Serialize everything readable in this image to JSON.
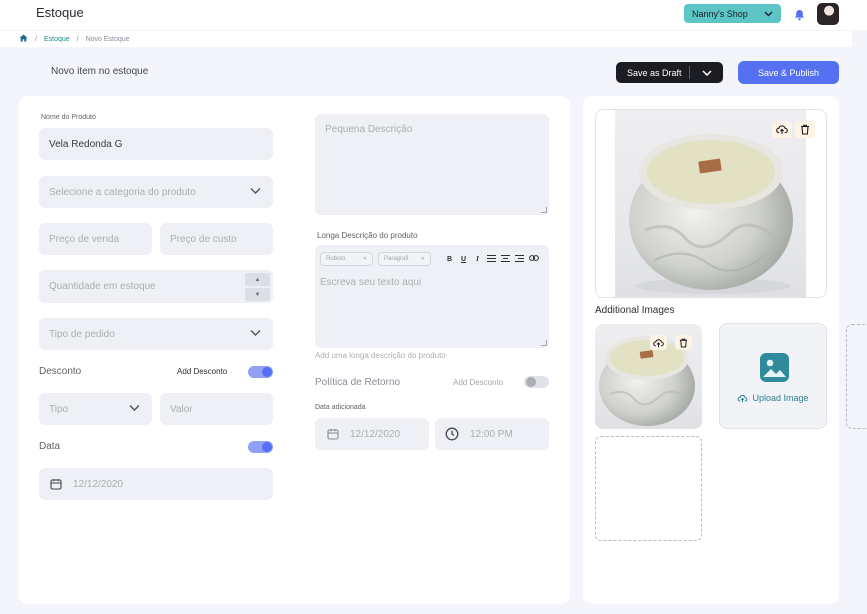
{
  "app": {
    "title": "Estoque"
  },
  "header": {
    "shop_name": "Nanny's Shop"
  },
  "breadcrumb": {
    "section": "Estoque",
    "current": "Novo Estoque"
  },
  "page": {
    "heading": "Novo item no estoque"
  },
  "actions": {
    "draft_label": "Save as Draft",
    "publish_label": "Save & Publish"
  },
  "form_left": {
    "product_name_label": "Nome do Produto",
    "product_name_value": "Vela Redonda G",
    "category_placeholder": "Selecione a categoria do produto",
    "sale_price_placeholder": "Preço de venda",
    "cost_price_placeholder": "Preço de custo",
    "stock_qty_placeholder": "Quantidade em estoque",
    "order_type_placeholder": "Tipo de pedido",
    "discount_label": "Desconto",
    "add_discount_label": "Add Desconto",
    "discount_type_placeholder": "Tipo",
    "discount_value_placeholder": "Valor",
    "date_label": "Data",
    "date_value": "12/12/2020"
  },
  "form_mid": {
    "short_desc_placeholder": "Pequena Descrição",
    "long_desc_label": "Longa Descrição do produto",
    "font_select": "Roboto",
    "paragraph_select": "Paragrafi",
    "editor_placeholder": "Escreva seu texto aqui",
    "long_desc_hint": "Add uma longa descrição do produto",
    "return_policy_label": "Política de Retorno",
    "return_add_discount_label": "Add Desconto",
    "date_added_label": "Data adicionada",
    "date_added_value": "12/12/2020",
    "time_added_value": "12:00 PM"
  },
  "images": {
    "additional_title": "Additional Images",
    "upload_label": "Upload Image"
  },
  "toggles": {
    "discount_on": true,
    "date_on": true,
    "return_policy_on": false
  },
  "colors": {
    "accent": "#5570f1",
    "shop_badge": "#5ec5c7",
    "teal_link": "#1a8b8c",
    "icon_chip": "#fff3e6"
  }
}
